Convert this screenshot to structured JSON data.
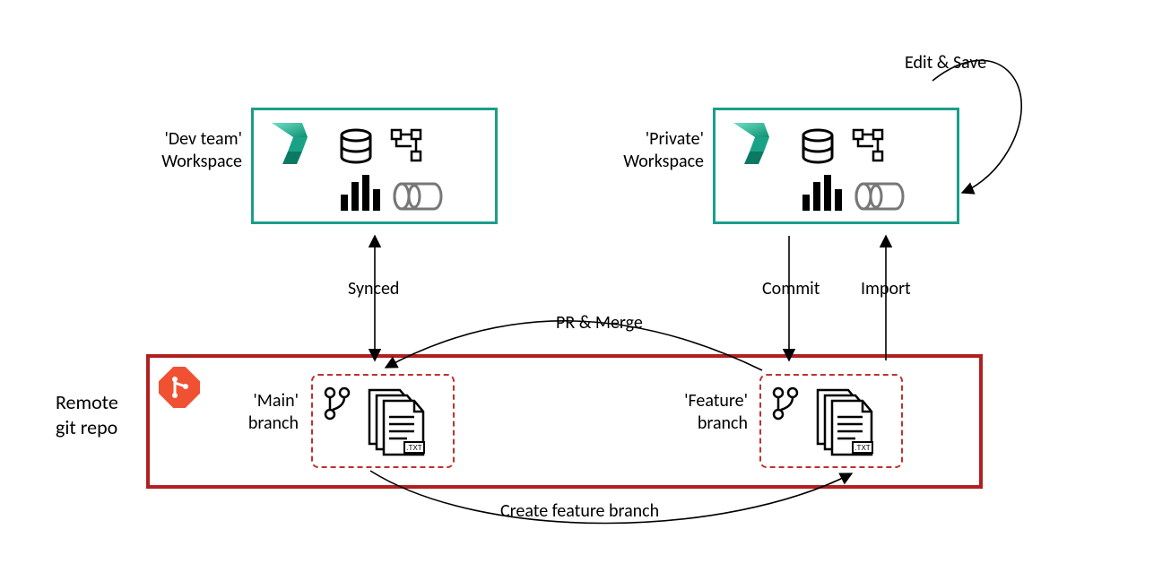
{
  "labels": {
    "dev_workspace_l1": "'Dev team'",
    "dev_workspace_l2": "Workspace",
    "private_workspace_l1": "'Private'",
    "private_workspace_l2": "Workspace",
    "remote_repo_l1": "Remote",
    "remote_repo_l2": "git repo",
    "main_branch_l1": "'Main'",
    "main_branch_l2": "branch",
    "feature_branch_l1": "'Feature'",
    "feature_branch_l2": "branch"
  },
  "arrows": {
    "edit_save": "Edit & Save",
    "synced": "Synced",
    "commit": "Commit",
    "import": "Import",
    "pr_merge": "PR & Merge",
    "create_feature": "Create feature branch"
  },
  "icons": {
    "fabric": "fabric-logo",
    "git": "git-logo",
    "db": "database-icon",
    "graph": "graph-icon",
    "bars": "bar-chart-icon",
    "lens": "lens-icon",
    "branch": "branch-icon",
    "files": "files-icon"
  },
  "concept": {
    "description": "Git-based development workflow between a shared 'Dev team' Fabric workspace synced to the 'Main' branch and a 'Private' Fabric workspace synced to a 'Feature' branch in a remote git repo.",
    "workspaces": [
      {
        "name": "Dev team",
        "synced_branch": "Main"
      },
      {
        "name": "Private",
        "synced_branch": "Feature"
      }
    ],
    "repo_branches": [
      "Main",
      "Feature"
    ],
    "flows": [
      {
        "from": "Private workspace",
        "to": "Private workspace",
        "label": "Edit & Save"
      },
      {
        "from": "Main branch",
        "to": "Dev team workspace",
        "label": "Synced",
        "direction": "bidirectional"
      },
      {
        "from": "Private workspace",
        "to": "Feature branch",
        "label": "Commit"
      },
      {
        "from": "Feature branch",
        "to": "Private workspace",
        "label": "Import"
      },
      {
        "from": "Feature branch",
        "to": "Main branch",
        "label": "PR & Merge"
      },
      {
        "from": "Main branch",
        "to": "Feature branch",
        "label": "Create feature branch"
      }
    ]
  }
}
